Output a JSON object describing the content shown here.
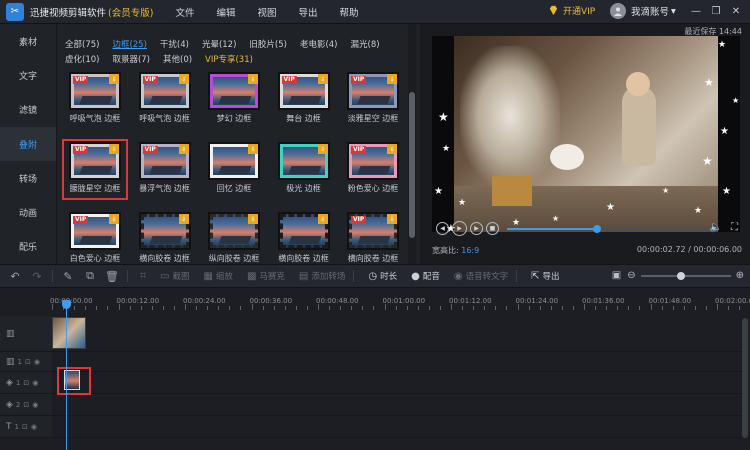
{
  "app": {
    "logo_glyph": "✂",
    "title": "迅捷视频剪辑软件",
    "edition": "(会员专版)",
    "menu": [
      "文件",
      "编辑",
      "视图",
      "导出",
      "帮助"
    ],
    "vip_button": "开通VIP",
    "account": "我滴账号",
    "account_caret": "▾",
    "window_controls": [
      "—",
      "❐",
      "✕"
    ],
    "save_status": "最近保存 14:44"
  },
  "sidebar": {
    "items": [
      "素材",
      "文字",
      "滤镜",
      "叠附",
      "转场",
      "动画",
      "配乐"
    ],
    "active_index": 3
  },
  "library": {
    "filters_row1": [
      "全部(75)",
      "边框(25)",
      "干扰(4)",
      "光晕(12)",
      "旧胶片(5)",
      "老电影(4)",
      "漏光(8)"
    ],
    "filters_row2": [
      "虚化(10)",
      "取景器(7)",
      "其他(0)",
      "VIP专享(31)"
    ],
    "active_filter": "边框(25)",
    "vip_filter": "VIP专享(31)",
    "vip_tag": "VIP",
    "download_glyph": "⇓",
    "tiles": [
      {
        "label": "呼吸气泡 边框",
        "vip": true,
        "frame": "#c9c3c8"
      },
      {
        "label": "呼吸气泡 边框",
        "vip": true,
        "frame": "#c3c9cc"
      },
      {
        "label": "梦幻 边框",
        "vip": false,
        "frame": "#b54ed6"
      },
      {
        "label": "舞台 边框",
        "vip": true,
        "frame": "#dcdcdc"
      },
      {
        "label": "淡雅星空 边框",
        "vip": true,
        "frame": "#8e96b9"
      },
      {
        "label": "朦胧星空 边框",
        "vip": true,
        "frame": "#d5d3d6",
        "selected": true
      },
      {
        "label": "暴浮气泡 边框",
        "vip": true,
        "frame": "#b7b0c9"
      },
      {
        "label": "回忆 边框",
        "vip": false,
        "frame": "#f0f0f0"
      },
      {
        "label": "极光 边框",
        "vip": false,
        "frame": "#3fd3c0"
      },
      {
        "label": "粉色爱心 边框",
        "vip": true,
        "frame": "#e898b8"
      },
      {
        "label": "白色爱心 边框",
        "vip": true,
        "frame": "#f2f2f2"
      },
      {
        "label": "横向胶卷 边框",
        "vip": false,
        "frame": "#222222"
      },
      {
        "label": "纵向胶卷 边框",
        "vip": false,
        "frame": "#2a2a2a"
      },
      {
        "label": "横向胶卷 边框",
        "vip": false,
        "frame": "#1c1c1c"
      },
      {
        "label": "横向胶卷 边框",
        "vip": true,
        "frame": "#262626"
      }
    ]
  },
  "preview": {
    "aspect_label": "宽高比:",
    "aspect_value": "16:9",
    "timecode": "00:00:02.72 / 00:00:06.00",
    "progress": 0.45,
    "controls": {
      "rewind": "◀",
      "play": "▶",
      "forward": "▶",
      "stop": "■",
      "volume": "🔈",
      "fullscreen": "⛶"
    },
    "star_glyph": "★"
  },
  "toolbar": {
    "icons": {
      "undo": "↶",
      "redo": "↷",
      "edit": "✎",
      "copy": "⧉",
      "delete": "🗑",
      "crop": "⌗",
      "screenshot": "⎘",
      "zoom_out": "⊖",
      "zoom_in": "⊕",
      "fit": "▣"
    },
    "items": [
      {
        "label": "截图",
        "glyph": "▭",
        "enabled": false
      },
      {
        "label": "缩放",
        "glyph": "▦",
        "enabled": false
      },
      {
        "label": "马赛克",
        "glyph": "▩",
        "enabled": false
      },
      {
        "label": "添加转场",
        "glyph": "▤",
        "enabled": false
      },
      {
        "label": "时长",
        "glyph": "◷",
        "enabled": true
      },
      {
        "label": "配音",
        "glyph": "●",
        "enabled": true
      },
      {
        "label": "语音转文字",
        "glyph": "◉",
        "enabled": false
      },
      {
        "label": "导出",
        "glyph": "⇱",
        "enabled": true
      }
    ]
  },
  "timeline": {
    "ruler_labels": [
      "00:00:00.00",
      "00:00:12.00",
      "00:00:24.00",
      "00:00:36.00",
      "00:00:48.00",
      "00:01:00.00",
      "00:01:12.00",
      "00:01:24.00",
      "00:01:36.00",
      "00:01:48.00",
      "00:02:00.00"
    ],
    "tracks": [
      {
        "icon": "▥",
        "num": ""
      },
      {
        "icon": "▥",
        "num": "1"
      },
      {
        "icon": "◈",
        "num": "1"
      },
      {
        "icon": "◈",
        "num": "2"
      },
      {
        "icon": "T",
        "num": "1"
      }
    ],
    "track_extras": [
      "⊡",
      "◉"
    ]
  },
  "colors": {
    "accent": "#3d9bf0",
    "vip_gold": "#e9b93a",
    "selection_red": "#e0353a"
  }
}
